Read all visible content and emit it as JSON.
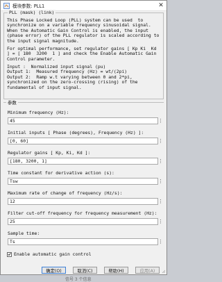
{
  "window": {
    "title": "模块参数: PLL1",
    "close_label": "✕"
  },
  "mask": {
    "legend": "PLL (mask) (link)",
    "description": [
      "This Phase Locked Loop (PLL) system can be used  to",
      "synchronize on a variable frequency sinusoidal signal.",
      "When the Automatic Gain Control is enabled, the input",
      "(phase error) of the PLL regulator is scaled according to",
      "the input signal magnitude.",
      "",
      "For optimal performance, set regulator gains [ Kp Ki  Kd",
      "] = [ 180  3200  1 ] and check the Enable Automatic Gain",
      "Control parameter.",
      "",
      "Input :  Normalized input signal (pu)",
      "Output 1:  Measured frequency (Hz) = wt/(2pi)",
      "Output 2:  Ramp w.t varying between 0 and 2*pi,",
      "synchronized on the zero-crossing (rising) of the",
      "fundamental of input signal."
    ]
  },
  "parameters": {
    "legend": "参数",
    "items": [
      {
        "label": "Minimum frequency (Hz):",
        "value": "45"
      },
      {
        "label": "Initial inputs [ Phase (degrees), Frequency (Hz) ]:",
        "value": "[0, 60]"
      },
      {
        "label": "Regulator gains [ Kp, Ki, Kd ]:",
        "value": "[180, 3200, 1]"
      },
      {
        "label": "Time constant for derivative action (s):",
        "value": "Tsw"
      },
      {
        "label": "Maximum rate of change of frequency (Hz/s):",
        "value": "12"
      },
      {
        "label": "Filter cut-off frequency for frequency measurement (Hz):",
        "value": "25"
      },
      {
        "label": "Sample time:",
        "value": "Ts"
      }
    ],
    "field_menu_glyph": "⋮",
    "agc_label": "Enable automatic gain control",
    "agc_checked": true,
    "check_glyph": "✓"
  },
  "buttons": {
    "ok": "确定(O)",
    "cancel": "取消(C)",
    "help": "帮助(H)",
    "apply": "应用(A)"
  },
  "caption": "信号 3 个信息",
  "colors": {
    "accent": "#3c7fd6",
    "window_bg": "#f0f0f0",
    "field_bg": "#ffffff"
  }
}
